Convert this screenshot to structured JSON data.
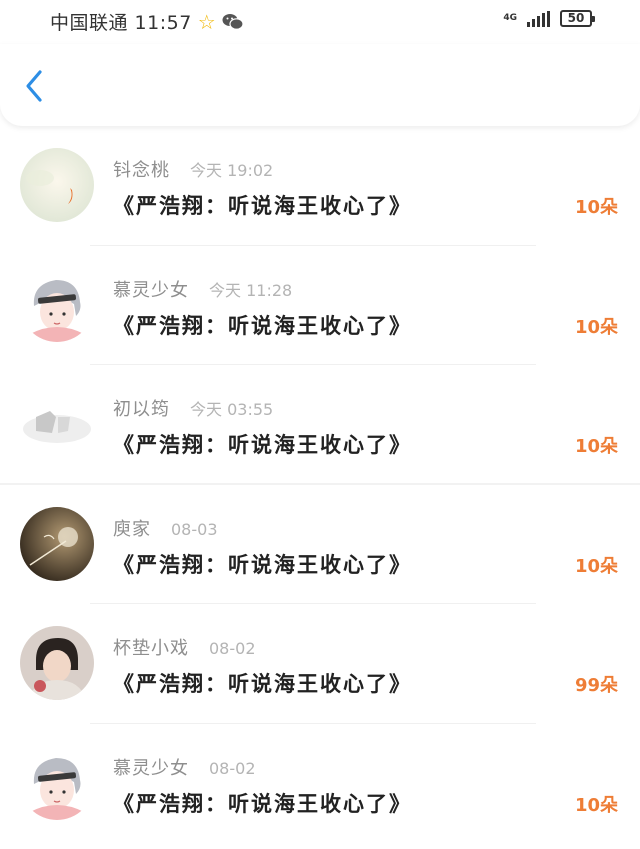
{
  "status_bar": {
    "carrier_time": "中国联通 11:57",
    "network": "4G",
    "battery": "50"
  },
  "header": {
    "back_icon": "chevron-left-icon",
    "accent_color": "#2d8ee5"
  },
  "gifts": [
    {
      "name": "钭念桃",
      "time": "今天 19:02",
      "title": "《严浩翔：听说海王收心了》",
      "amount": "10朵"
    },
    {
      "name": "慕灵少女",
      "time": "今天 11:28",
      "title": "《严浩翔：听说海王收心了》",
      "amount": "10朵"
    },
    {
      "name": "初以筠",
      "time": "今天 03:55",
      "title": "《严浩翔：听说海王收心了》",
      "amount": "10朵"
    },
    {
      "name": "庾家",
      "time": "08-03",
      "title": "《严浩翔：听说海王收心了》",
      "amount": "10朵"
    },
    {
      "name": "杯垫小戏",
      "time": "08-02",
      "title": "《严浩翔：听说海王收心了》",
      "amount": "99朵"
    },
    {
      "name": "慕灵少女",
      "time": "08-02",
      "title": "《严浩翔：听说海王收心了》",
      "amount": "10朵"
    }
  ],
  "colors": {
    "amount": "#ee7d36",
    "name": "#8e8e8e",
    "time": "#b4b4b4"
  }
}
